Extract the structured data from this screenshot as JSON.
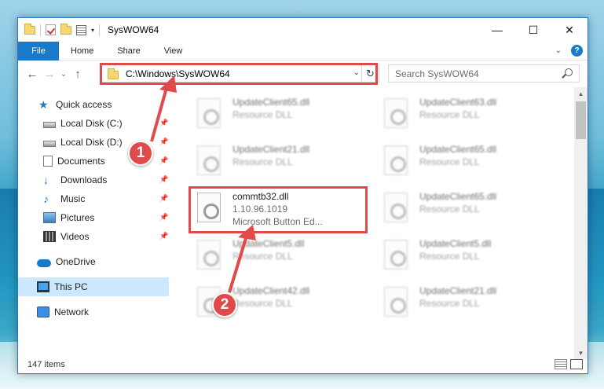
{
  "window": {
    "title": "SysWOW64",
    "controls": {
      "minimize": "—",
      "maximize": "☐",
      "close": "✕"
    }
  },
  "ribbon": {
    "tabs": [
      "File",
      "Home",
      "Share",
      "View"
    ],
    "help": "?"
  },
  "address_bar": {
    "path": "C:\\Windows\\SysWOW64"
  },
  "search": {
    "placeholder": "Search SysWOW64"
  },
  "sidebar": {
    "items": [
      {
        "label": "Quick access",
        "icon": "star-icon"
      },
      {
        "label": "Local Disk (C:)",
        "icon": "drive-icon",
        "pinned": true
      },
      {
        "label": "Local Disk (D:)",
        "icon": "drive-icon",
        "pinned": true
      },
      {
        "label": "Documents",
        "icon": "documents-icon",
        "pinned": true
      },
      {
        "label": "Downloads",
        "icon": "download-icon",
        "pinned": true
      },
      {
        "label": "Music",
        "icon": "music-icon",
        "pinned": true
      },
      {
        "label": "Pictures",
        "icon": "pictures-icon",
        "pinned": true
      },
      {
        "label": "Videos",
        "icon": "videos-icon",
        "pinned": true
      },
      {
        "label": "OneDrive",
        "icon": "onedrive-icon"
      },
      {
        "label": "This PC",
        "icon": "pc-icon",
        "selected": true
      },
      {
        "label": "Network",
        "icon": "network-icon"
      }
    ]
  },
  "files": [
    {
      "name": "UpdateClient65.dll",
      "type": "Resource DLL"
    },
    {
      "name": "UpdateClient63.dll",
      "type": "Resource DLL"
    },
    {
      "name": "UpdateClient21.dll",
      "type": "Resource DLL"
    },
    {
      "name": "UpdateClient65.dll",
      "type": "Resource DLL"
    },
    {
      "name": "commtb32.dll",
      "version": "1.10.96.1019",
      "description": "Microsoft Button Ed...",
      "highlighted": true
    },
    {
      "name": "UpdateClient65.dll",
      "type": "Resource DLL"
    },
    {
      "name": "UpdateClient5.dll",
      "type": "Resource DLL"
    },
    {
      "name": "UpdateClient5.dll",
      "type": "Resource DLL"
    },
    {
      "name": "UpdateClient42.dll",
      "type": "Resource DLL"
    },
    {
      "name": "UpdateClient21.dll",
      "type": "Resource DLL"
    }
  ],
  "status": {
    "item_count": "147 items"
  },
  "callouts": [
    "1",
    "2"
  ],
  "colors": {
    "accent": "#1979ca",
    "highlight": "#e04a4a",
    "selected_nav": "#cce8ff"
  }
}
